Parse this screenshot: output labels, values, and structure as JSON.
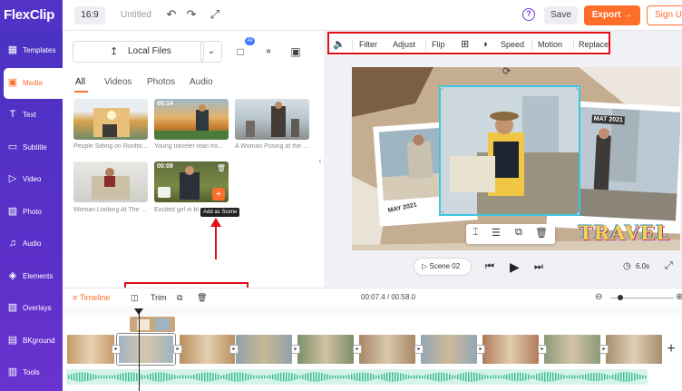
{
  "app": {
    "logo_text": "FlexClip",
    "ratio": "16:9",
    "title": "Untitled",
    "save_label": "Save",
    "export_label": "Export →",
    "signup_label": "Sign U"
  },
  "sidebar": {
    "items": [
      {
        "label": "Templates",
        "icon": "templates-icon",
        "glyph": "▦"
      },
      {
        "label": "Media",
        "icon": "media-icon",
        "glyph": "▣"
      },
      {
        "label": "Text",
        "icon": "text-icon",
        "glyph": "T"
      },
      {
        "label": "Subtitle",
        "icon": "subtitle-icon",
        "glyph": "▭"
      },
      {
        "label": "Video",
        "icon": "video-icon",
        "glyph": "▷"
      },
      {
        "label": "Photo",
        "icon": "photo-icon",
        "glyph": "▨"
      },
      {
        "label": "Audio",
        "icon": "audio-icon",
        "glyph": "♫"
      },
      {
        "label": "Elements",
        "icon": "elements-icon",
        "glyph": "◈"
      },
      {
        "label": "Overlays",
        "icon": "overlays-icon",
        "glyph": "▧"
      },
      {
        "label": "BKground",
        "icon": "background-icon",
        "glyph": "▤"
      },
      {
        "label": "Tools",
        "icon": "tools-icon",
        "glyph": "▥"
      }
    ]
  },
  "panel": {
    "local_files_label": "Local Files",
    "ai_badge": "AI",
    "tabs": [
      "All",
      "Videos",
      "Photos",
      "Audio"
    ],
    "media": [
      {
        "caption": "People Sitting on Roofto...",
        "duration": ""
      },
      {
        "caption": "Young traveler lean fro...",
        "duration": "00:14"
      },
      {
        "caption": "A Woman Posing at the ...",
        "duration": ""
      },
      {
        "caption": "Woman Looking At The ...",
        "duration": ""
      },
      {
        "caption": "Excited girl in bl",
        "duration": "00:08"
      }
    ],
    "tooltip": "Add as Scene"
  },
  "toolbar": {
    "items": [
      "Filter",
      "Adjust",
      "Flip",
      "Speed",
      "Motion",
      "Replace"
    ]
  },
  "canvas": {
    "date_label_1": "MAY 2021",
    "date_label_2": "MAT 2021",
    "sticker_text": "TRAVEL"
  },
  "player": {
    "scene_label": "Scene 02",
    "duration": "6.0s"
  },
  "timeline": {
    "label": "Timeline",
    "trim_label": "Trim",
    "time_current": "00:07.4",
    "time_total": "00:58.0"
  },
  "colors": {
    "accent": "#ff6d2b",
    "sidebar": "#5332c8",
    "highlight": "#e0101a",
    "selection": "#3ec6e0"
  }
}
